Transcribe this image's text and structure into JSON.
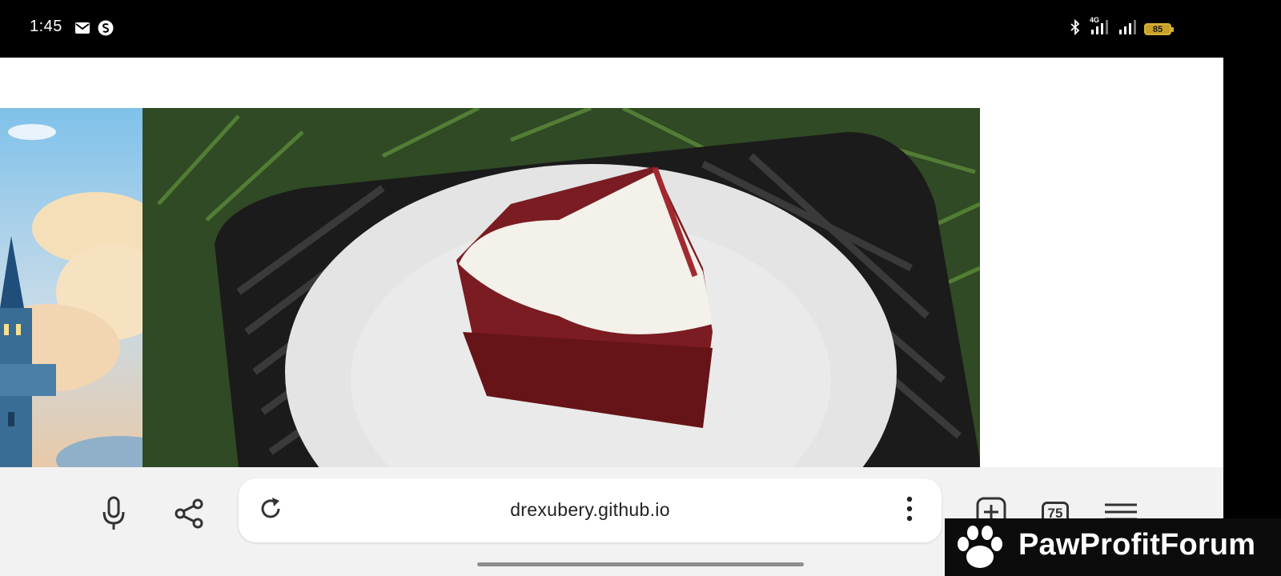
{
  "status_bar": {
    "time": "1:45",
    "left_icons": [
      "mail-icon",
      "s-app-icon"
    ],
    "right_icons": [
      "bluetooth-icon",
      "signal-4g-icon",
      "signal-icon"
    ],
    "network": "4G",
    "battery": "85"
  },
  "web_content": {
    "images": [
      "castle-sky-illustration",
      "red-velvet-cake-photo"
    ]
  },
  "toolbar": {
    "url": "drexubery.github.io",
    "tab_count": "75",
    "icons": [
      "mic-icon",
      "share-icon",
      "reload-icon",
      "more-vert-icon",
      "add-tab-icon",
      "tabs-icon",
      "menu-icon"
    ]
  },
  "banner": {
    "text": "PawProfitForum",
    "icon": "paw-icon"
  },
  "colors": {
    "status_bar_bg": "#000000",
    "toolbar_bg": "#f2f2f2",
    "battery": "#c9a12a",
    "banner_bg": "#0c0c0c"
  }
}
